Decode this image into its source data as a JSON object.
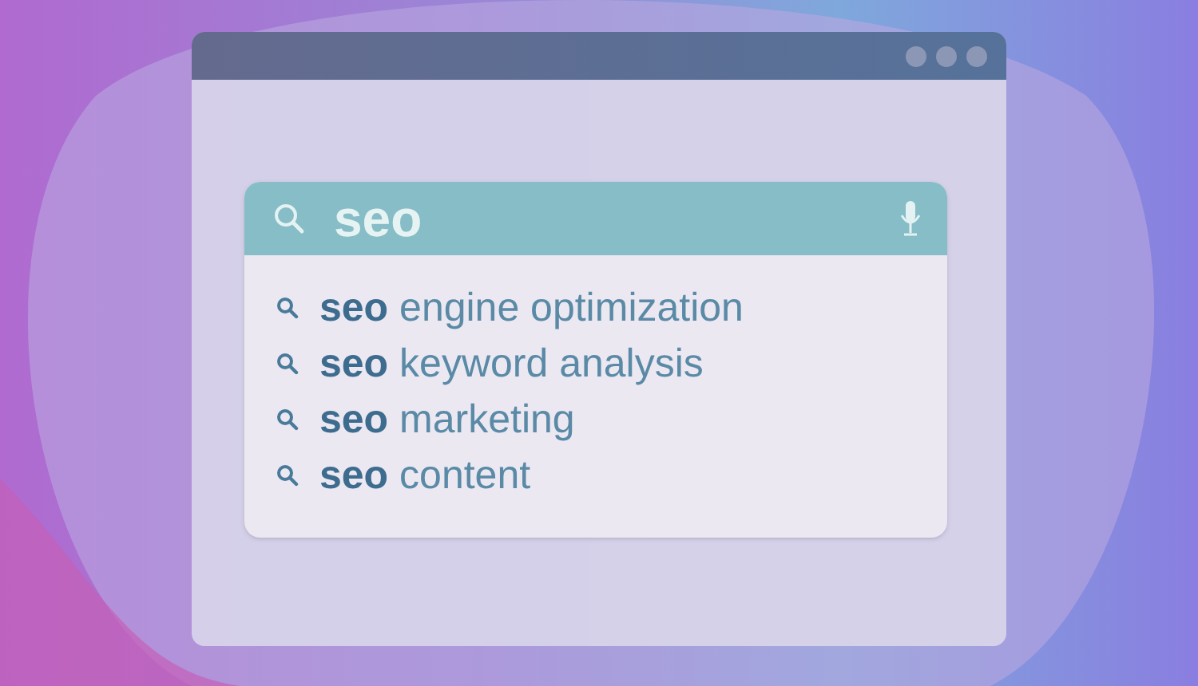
{
  "search": {
    "value": "seo"
  },
  "suggestions": [
    "**seo** engine optimization",
    "**seo** keyword analysis",
    "**seo** marketing",
    "**seo** content"
  ]
}
